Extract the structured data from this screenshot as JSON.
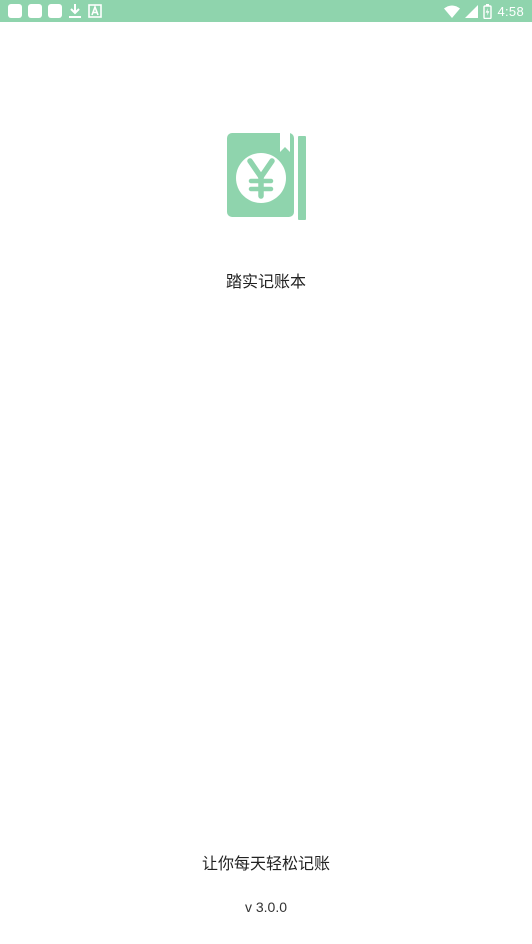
{
  "status_bar": {
    "time": "4:58",
    "background_color": "#8fd4ad",
    "left_icons": [
      "notification-square-icon",
      "notification-square-icon",
      "notification-square-icon",
      "download-icon",
      "text-a-icon"
    ],
    "right_icons": [
      "wifi-icon",
      "signal-icon",
      "battery-icon"
    ]
  },
  "splash": {
    "logo_icon": "yen-book-icon",
    "logo_color": "#8fd4ad",
    "app_name": "踏实记账本",
    "slogan": "让你每天轻松记账",
    "version": "v 3.0.0"
  }
}
